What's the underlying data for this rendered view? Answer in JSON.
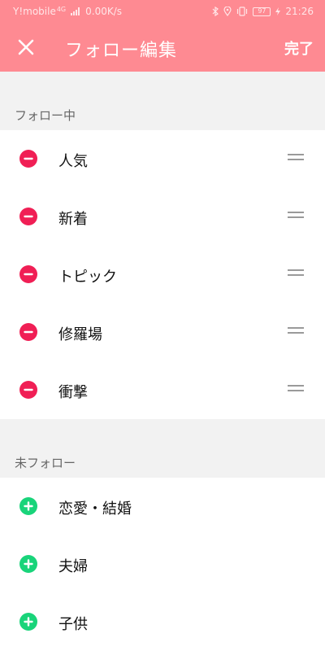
{
  "status_bar": {
    "carrier": "Y!mobile",
    "network_type": "4G",
    "speed": "0.00K/s",
    "battery": "97",
    "time": "21:26"
  },
  "toolbar": {
    "title": "フォロー編集",
    "done_label": "完了"
  },
  "following": {
    "header": "フォロー中",
    "items": [
      {
        "label": "人気"
      },
      {
        "label": "新着"
      },
      {
        "label": "トピック"
      },
      {
        "label": "修羅場"
      },
      {
        "label": "衝撃"
      }
    ]
  },
  "not_following": {
    "header": "未フォロー",
    "items": [
      {
        "label": "恋愛・結婚"
      },
      {
        "label": "夫婦"
      },
      {
        "label": "子供"
      }
    ]
  },
  "colors": {
    "app_bar": "#fe8a92",
    "remove": "#f01f55",
    "add": "#19d47a"
  }
}
